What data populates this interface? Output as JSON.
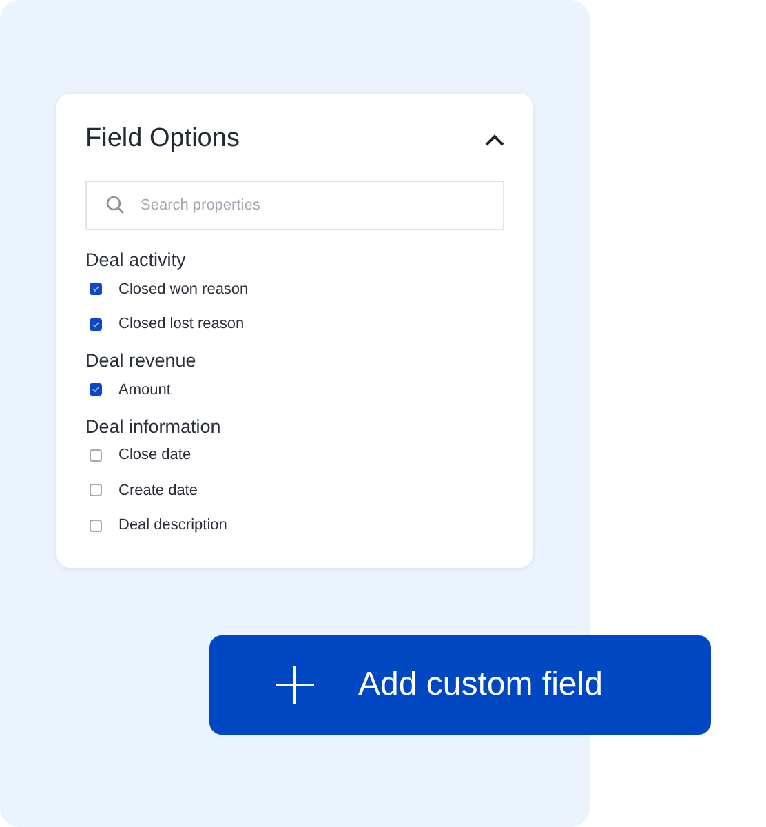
{
  "panel": {
    "title": "Field Options",
    "expanded": true,
    "search": {
      "placeholder": "Search properties"
    },
    "groups": [
      {
        "title": "Deal activity",
        "items": [
          {
            "label": "Closed won reason",
            "checked": true
          },
          {
            "label": "Closed lost reason",
            "checked": true
          }
        ]
      },
      {
        "title": "Deal revenue",
        "items": [
          {
            "label": "Amount",
            "checked": true
          }
        ]
      },
      {
        "title": "Deal information",
        "items": [
          {
            "label": "Close date",
            "checked": false
          },
          {
            "label": "Create date",
            "checked": false
          },
          {
            "label": "Deal description",
            "checked": false
          }
        ]
      }
    ]
  },
  "button": {
    "label": "Add custom field"
  }
}
